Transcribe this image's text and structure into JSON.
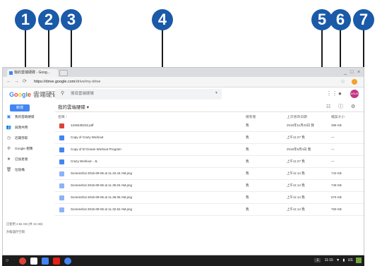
{
  "callouts": [
    "1",
    "2",
    "3",
    "4",
    "5",
    "6",
    "7"
  ],
  "browser": {
    "tab_title": "我的雲端硬碟 - Goog...",
    "url_host": "https://drive.google.com",
    "url_path": "/drive/my-drive",
    "window_controls": [
      "_",
      "□",
      "×"
    ]
  },
  "drive": {
    "logo_letters": [
      "G",
      "o",
      "o",
      "g",
      "l",
      "e"
    ],
    "logo_colors": [
      "#4285f4",
      "#ea4335",
      "#fbbc05",
      "#4285f4",
      "#34a853",
      "#ea4335"
    ],
    "product": "雲端硬碟",
    "search_placeholder": "搜尋雲端硬碟",
    "new_button": "新增",
    "breadcrumb": "我的雲端硬碟 ▾",
    "avatar_text": "ASUS"
  },
  "sidebar": {
    "items": [
      {
        "label": "我的雲端硬碟",
        "icon": "drive-icon"
      },
      {
        "label": "與我共用",
        "icon": "shared-icon"
      },
      {
        "label": "近期存取",
        "icon": "clock-icon"
      },
      {
        "label": "Google 相簿",
        "icon": "photos-icon"
      },
      {
        "label": "已加星號",
        "icon": "star-icon"
      },
      {
        "label": "垃圾桶",
        "icon": "trash-icon"
      }
    ],
    "quota": "已使用 2.56 GB (共 15 GB)",
    "upgrade": "升級儲存空間"
  },
  "table": {
    "headers": {
      "name": "名稱 ↑",
      "owner": "擁有者",
      "modified": "上次修改日期",
      "size": "檔案大小"
    },
    "rows": [
      {
        "name": "1248435232.pdf",
        "type": "pdf",
        "owner": "我",
        "modified": "2015年11月23日 我",
        "size": "286 KB"
      },
      {
        "name": "Copy of Crazy Workout",
        "type": "doc",
        "owner": "我",
        "modified": "上午11:27 我",
        "size": "—"
      },
      {
        "name": "Copy of El Ocean Workout Program",
        "type": "doc",
        "owner": "我",
        "modified": "2015年5月4日 我",
        "size": "—"
      },
      {
        "name": "Crazy Workout - JL",
        "type": "doc",
        "owner": "我",
        "modified": "上午11:27 我",
        "size": "—"
      },
      {
        "name": "Screenshot 2016-09-06 at 11.34.44 AM.png",
        "type": "img",
        "owner": "我",
        "modified": "上午11:14 我",
        "size": "743 KB"
      },
      {
        "name": "Screenshot 2016-09-06 at 11.35.04 AM.png",
        "type": "img",
        "owner": "我",
        "modified": "上午11:14 我",
        "size": "748 KB"
      },
      {
        "name": "Screenshot 2016-09-06 at 11.36.06 AM.png",
        "type": "img",
        "owner": "我",
        "modified": "上午11:14 我",
        "size": "676 KB"
      },
      {
        "name": "Screenshot 2016-09-06 at 11.32.52 AM.png",
        "type": "img",
        "owner": "我",
        "modified": "上午11:14 我",
        "size": "769 KB"
      }
    ]
  },
  "taskbar": {
    "tray_count": "1",
    "time": "11:15",
    "locale": "US"
  },
  "colors": {
    "accent": "#4285f4",
    "callout": "#1a5aa8",
    "pdf": "#db4437",
    "doc": "#4285f4",
    "img": "#8ab4f8"
  }
}
